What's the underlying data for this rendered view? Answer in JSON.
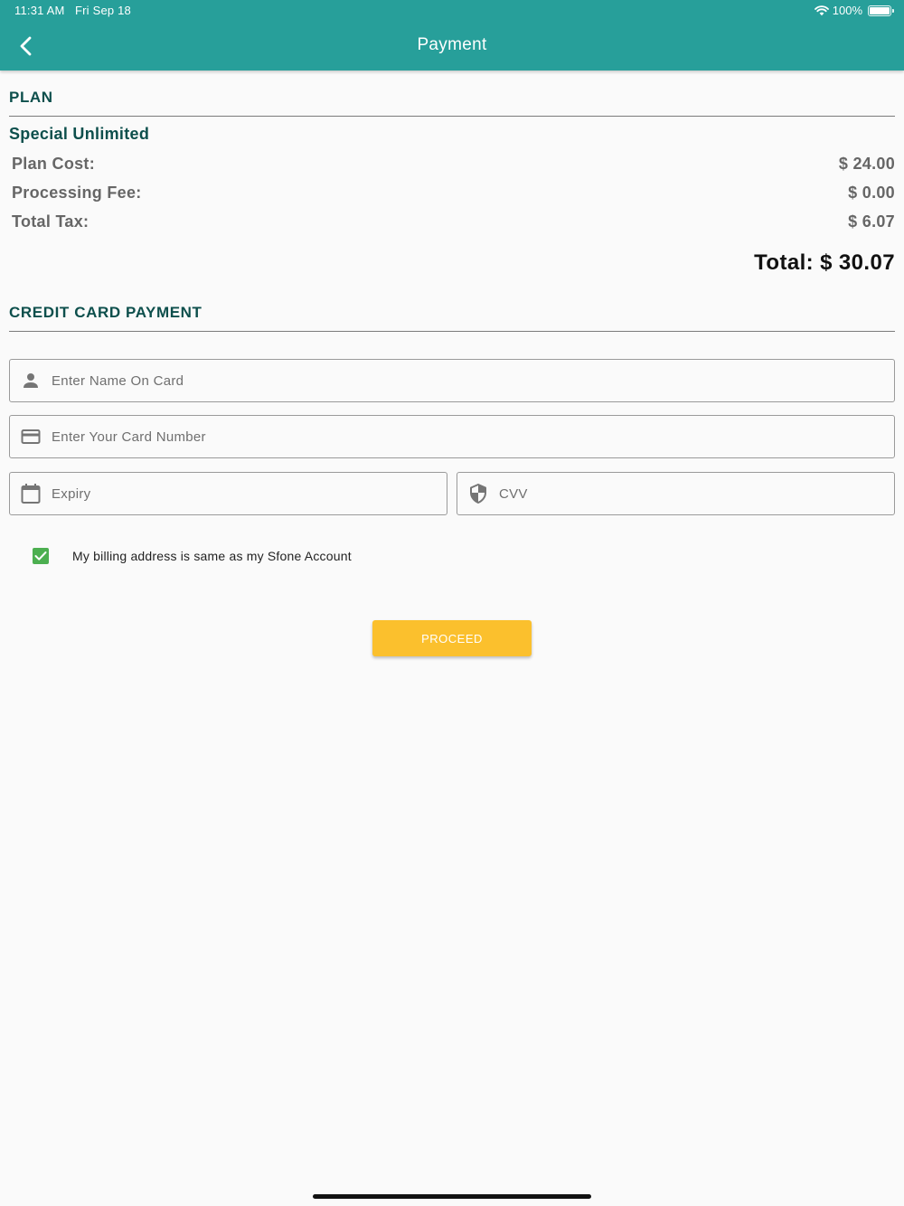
{
  "status_bar": {
    "time": "11:31 AM",
    "date": "Fri Sep 18",
    "battery": "100%",
    "icons": [
      "wifi-icon",
      "battery-icon"
    ]
  },
  "header": {
    "title": "Payment",
    "back_icon": "chevron-left-icon",
    "background_color": "#279f9a"
  },
  "plan_section": {
    "heading": "PLAN",
    "plan_name": "Special Unlimited",
    "rows": [
      {
        "label": "Plan Cost:",
        "value": "$ 24.00"
      },
      {
        "label": "Processing Fee:",
        "value": "$ 0.00"
      },
      {
        "label": "Total Tax:",
        "value": "$ 6.07"
      }
    ],
    "total": "Total: $ 30.07"
  },
  "payment_section": {
    "heading": "CREDIT CARD PAYMENT",
    "fields": {
      "name": {
        "placeholder": "Enter Name On Card",
        "value": "",
        "icon": "person-icon"
      },
      "card_number": {
        "placeholder": "Enter Your Card Number",
        "value": "",
        "icon": "credit-card-icon"
      },
      "expiry": {
        "placeholder": "Expiry",
        "value": "",
        "icon": "calendar-icon"
      },
      "cvv": {
        "placeholder": "CVV",
        "value": "",
        "icon": "shield-icon"
      }
    },
    "billing_checkbox": {
      "label": "My billing address is same as my Sfone Account",
      "checked": true,
      "color": "#4caf50"
    }
  },
  "proceed_button": {
    "label": "PROCEED",
    "color": "#fbc02d"
  },
  "colors": {
    "accent_dark": "#0d4f4c",
    "page_background": "#fafafa"
  }
}
